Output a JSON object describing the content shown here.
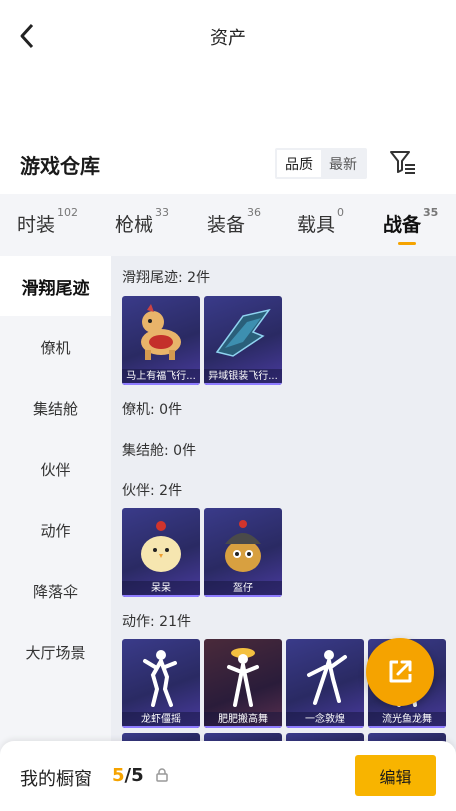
{
  "header": {
    "title": "资产",
    "back_icon": "chevron-left-icon"
  },
  "warehouse": {
    "title": "游戏仓库",
    "sort_options": [
      "品质",
      "最新"
    ],
    "filter_icon": "filter-icon"
  },
  "tabs": [
    {
      "label": "时装",
      "count": "102",
      "active": false
    },
    {
      "label": "枪械",
      "count": "33",
      "active": false
    },
    {
      "label": "装备",
      "count": "36",
      "active": false
    },
    {
      "label": "载具",
      "count": "0",
      "active": false
    },
    {
      "label": "战备",
      "count": "35",
      "active": true
    }
  ],
  "sidebar": [
    {
      "label": "滑翔尾迹",
      "active": true
    },
    {
      "label": "僚机",
      "active": false
    },
    {
      "label": "集结舱",
      "active": false
    },
    {
      "label": "伙伴",
      "active": false
    },
    {
      "label": "动作",
      "active": false
    },
    {
      "label": "降落伞",
      "active": false
    },
    {
      "label": "大厅场景",
      "active": false
    }
  ],
  "sections": [
    {
      "title": "滑翔尾迹: 2件",
      "items": [
        "马上有福飞行...",
        "异域银装飞行..."
      ]
    },
    {
      "title": "僚机: 0件",
      "items": []
    },
    {
      "title": "集结舱: 0件",
      "items": []
    },
    {
      "title": "伙伴: 2件",
      "items": [
        "呆呆",
        "盔仔"
      ]
    },
    {
      "title": "动作: 21件",
      "items": [
        "龙虾僵摇",
        "肥肥搬高舞",
        "一念敦煌",
        "流光鱼龙舞"
      ]
    }
  ],
  "fab": {
    "icon": "share-external-icon"
  },
  "bottom_bar": {
    "label": "我的橱窗",
    "current": "5",
    "separator": "/",
    "total": "5",
    "lock_icon": "lock-icon",
    "edit_label": "编辑"
  },
  "colors": {
    "accent": "#f5a300",
    "card_bg": "#2a2a63",
    "tab_bg": "#f4f5f8"
  }
}
